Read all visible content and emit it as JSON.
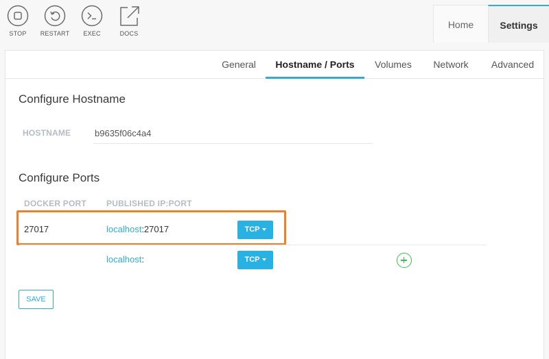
{
  "toolbar": {
    "stop_label": "STOP",
    "restart_label": "RESTART",
    "exec_label": "EXEC",
    "docs_label": "DOCS"
  },
  "top_tabs": [
    {
      "label": "Home",
      "active": false
    },
    {
      "label": "Settings",
      "active": true
    }
  ],
  "sub_tabs": [
    {
      "label": "General",
      "active": false
    },
    {
      "label": "Hostname / Ports",
      "active": true
    },
    {
      "label": "Volumes",
      "active": false
    },
    {
      "label": "Network",
      "active": false
    },
    {
      "label": "Advanced",
      "active": false
    }
  ],
  "hostname_section": {
    "title": "Configure Hostname",
    "label": "HOSTNAME",
    "value": "b9635f06c4a4"
  },
  "ports_section": {
    "title": "Configure Ports",
    "col_docker_port": "DOCKER PORT",
    "col_published": "PUBLISHED IP:PORT",
    "rows": [
      {
        "docker_port": "27017",
        "host": "localhost",
        "port_suffix": ":27017",
        "protocol": "TCP"
      },
      {
        "docker_port": "",
        "host": "localhost",
        "port_suffix": ":",
        "protocol": "TCP"
      }
    ]
  },
  "save_label": "SAVE",
  "colors": {
    "accent": "#2eacd5",
    "tcp_button": "#27b2e3",
    "add_icon": "#3ac14a",
    "highlight": "#f07f28"
  },
  "icons": [
    "stop-icon",
    "restart-icon",
    "exec-icon",
    "docs-icon",
    "caret-down-icon",
    "add-circle-icon"
  ]
}
